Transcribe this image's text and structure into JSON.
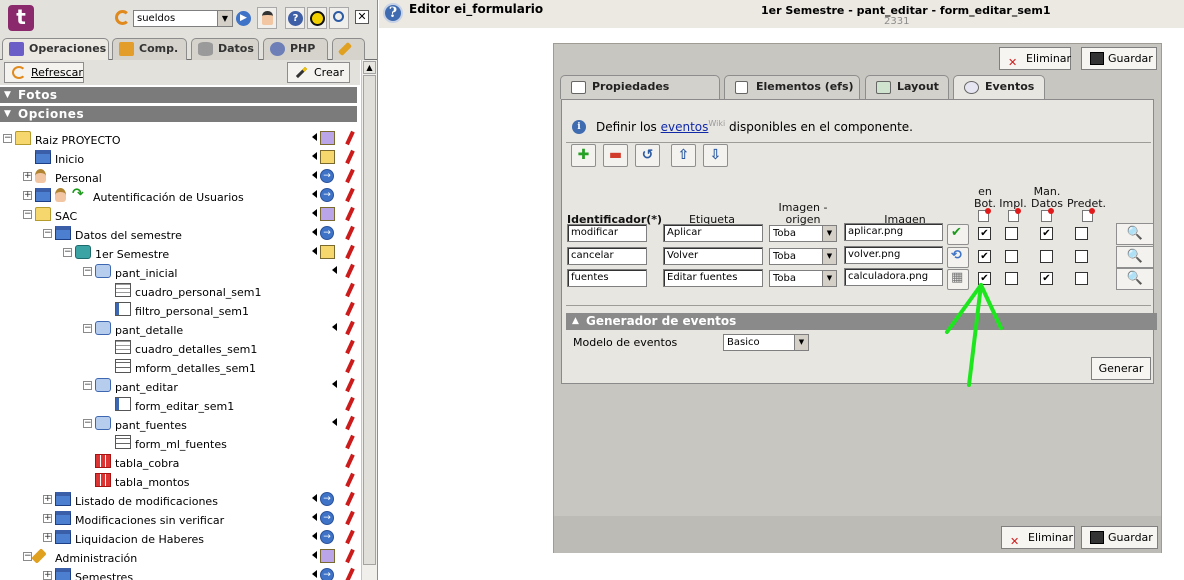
{
  "left": {
    "project_select": "sueldos",
    "tabs": [
      {
        "label": "Operaciones",
        "color": "#6b5ec7"
      },
      {
        "label": "Comp.",
        "color": "#e39d2a"
      },
      {
        "label": "Datos",
        "color": "#9a9a9a"
      },
      {
        "label": "PHP",
        "color": "#6d7fb6"
      }
    ],
    "actions": {
      "refresh": "Refrescar",
      "create": "Crear"
    },
    "sections": {
      "photos": "Fotos",
      "options": "Opciones"
    },
    "tree": [
      {
        "label": "Raiz PROYECTO",
        "icon": "folder-icon"
      },
      {
        "label": "Inicio",
        "icon": "window-icon"
      },
      {
        "label": "Personal",
        "icon": "user-icon"
      },
      {
        "label": "Autentificación de Usuarios",
        "icon": "window-icon"
      },
      {
        "label": "SAC",
        "icon": "folder-icon"
      },
      {
        "label": "Datos del semestre",
        "icon": "window-icon"
      },
      {
        "label": "1er Semestre",
        "icon": "component-icon"
      },
      {
        "label": "pant_inicial",
        "icon": "screen-icon"
      },
      {
        "label": "cuadro_personal_sem1",
        "icon": "grid-icon"
      },
      {
        "label": "filtro_personal_sem1",
        "icon": "form-icon"
      },
      {
        "label": "pant_detalle",
        "icon": "screen-icon"
      },
      {
        "label": "cuadro_detalles_sem1",
        "icon": "grid-icon"
      },
      {
        "label": "mform_detalles_sem1",
        "icon": "mform-icon"
      },
      {
        "label": "pant_editar",
        "icon": "screen-icon"
      },
      {
        "label": "form_editar_sem1",
        "icon": "form-icon"
      },
      {
        "label": "pant_fuentes",
        "icon": "screen-icon"
      },
      {
        "label": "form_ml_fuentes",
        "icon": "mform-icon"
      },
      {
        "label": "tabla_cobra",
        "icon": "table-icon"
      },
      {
        "label": "tabla_montos",
        "icon": "table-icon"
      },
      {
        "label": "Listado de modificaciones",
        "icon": "window-icon"
      },
      {
        "label": "Modificaciones sin verificar",
        "icon": "window-icon"
      },
      {
        "label": "Liquidacion de Haberes",
        "icon": "window-icon"
      },
      {
        "label": "Administración",
        "icon": "tools-icon"
      },
      {
        "label": "Semestres",
        "icon": "window-icon"
      }
    ]
  },
  "header": {
    "editor_title": "Editor ei_formulario",
    "context_title": "1er Semestre - pant_editar - form_editar_sem1",
    "context_id": "2331"
  },
  "editor": {
    "delete_label": "Eliminar",
    "save_label": "Guardar",
    "tabs": [
      "Propiedades basicas",
      "Elementos (efs)",
      "Layout",
      "Eventos"
    ],
    "info": {
      "prefix": "Definir los",
      "link": "eventos",
      "sup": "Wiki",
      "suffix": "disponibles en el componente."
    },
    "columns": {
      "id": "Identificador(*)",
      "label": "Etiqueta",
      "origin_1": "Imagen -",
      "origin_2": "origen",
      "image": "Imagen",
      "in_bot_1": "en",
      "in_bot_2": "Bot.",
      "impl": "Impl.",
      "man_1": "Man.",
      "man_2": "Datos",
      "predet": "Predet."
    },
    "events": [
      {
        "id": "modificar",
        "label": "Aplicar",
        "origin": "Toba",
        "image": "aplicar.png",
        "icon": "check-icon",
        "en_bot": true,
        "impl": false,
        "man_datos": true,
        "predet": false
      },
      {
        "id": "cancelar",
        "label": "Volver",
        "origin": "Toba",
        "image": "volver.png",
        "icon": "back-arrow-icon",
        "en_bot": true,
        "impl": false,
        "man_datos": false,
        "predet": false
      },
      {
        "id": "fuentes",
        "label": "Editar fuentes",
        "origin": "Toba",
        "image": "calculadora.png",
        "icon": "calculator-icon",
        "en_bot": true,
        "impl": false,
        "man_datos": true,
        "predet": false
      }
    ],
    "generator": {
      "title": "Generador de eventos",
      "model_label": "Modelo de eventos",
      "model_value": "Basico",
      "button": "Generar"
    }
  },
  "colors": {
    "annotation_arrow": "#1ee61e",
    "section_bg": "#7b7b7b",
    "link": "#1029a8"
  }
}
